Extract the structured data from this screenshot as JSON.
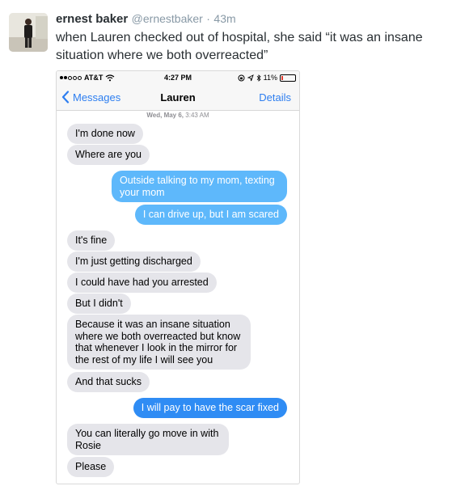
{
  "tweet": {
    "display_name": "ernest baker",
    "handle": "@ernestbaker",
    "separator": "·",
    "time": "43m",
    "text": "when Lauren checked out of hospital, she said “it was an insane situation where we both overreacted”"
  },
  "phone": {
    "status_bar": {
      "carrier": "AT&T",
      "time": "4:27 PM",
      "battery": "11%",
      "battery_level": 0.11
    },
    "nav": {
      "back_label": "Messages",
      "title": "Lauren",
      "details_label": "Details"
    },
    "date_day": "Wed, May 6,",
    "date_time": "3:43 AM",
    "messages": [
      {
        "dir": "in",
        "text": "I'm done now"
      },
      {
        "dir": "in",
        "text": "Where are you"
      },
      {
        "dir": "out",
        "text": "Outside talking to my mom, texting your mom"
      },
      {
        "dir": "out",
        "text": "I can drive up, but I am scared"
      },
      {
        "dir": "in",
        "text": "It's fine"
      },
      {
        "dir": "in",
        "text": "I'm just getting discharged"
      },
      {
        "dir": "in",
        "text": "I could have had you arrested"
      },
      {
        "dir": "in",
        "text": "But I didn't"
      },
      {
        "dir": "in",
        "text": "Because it was an insane situation where we both overreacted but know that whenever I look in the mirror for the rest of my life I will see you"
      },
      {
        "dir": "in",
        "text": "And that sucks"
      },
      {
        "dir": "out",
        "text": "I will pay to have the scar fixed"
      },
      {
        "dir": "in",
        "text": "You can literally go move in with Rosie"
      },
      {
        "dir": "in",
        "text": "Please"
      }
    ]
  },
  "colors": {
    "imessage_blue": "#2f8cf4",
    "imessage_light_blue": "#5eb8fb",
    "received_gray": "#e5e5ea",
    "ios_link_blue": "#2d7ef0"
  },
  "icons": {
    "avatar": "person-photo",
    "back": "chevron-left-icon",
    "wifi": "wifi-icon",
    "location": "location-arrow-icon",
    "bluetooth": "bluetooth-icon",
    "lock": "rotation-lock-icon",
    "battery": "battery-icon"
  }
}
